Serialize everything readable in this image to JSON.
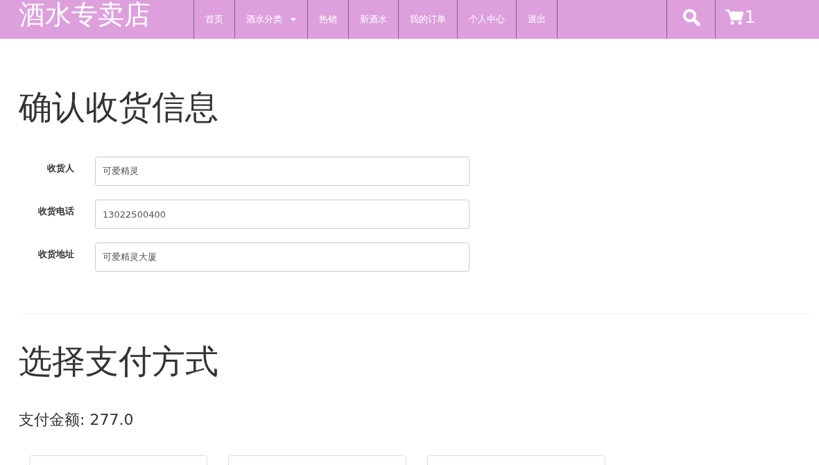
{
  "navbar": {
    "brand": "酒水专卖店",
    "items": [
      {
        "label": "首页",
        "kind": "link"
      },
      {
        "label": "酒水分类",
        "kind": "dropdown"
      },
      {
        "label": "热销",
        "kind": "link"
      },
      {
        "label": "新酒水",
        "kind": "link"
      },
      {
        "label": "我的订单",
        "kind": "link"
      },
      {
        "label": "个人中心",
        "kind": "link"
      },
      {
        "label": "退出",
        "kind": "link"
      }
    ],
    "cart_count": "1"
  },
  "shipping": {
    "title": "确认收货信息",
    "fields": [
      {
        "label": "收货人",
        "value": "可爱精灵"
      },
      {
        "label": "收货电话",
        "value": "13022500400"
      },
      {
        "label": "收货地址",
        "value": "可爱精灵大厦"
      }
    ]
  },
  "payment": {
    "title": "选择支付方式",
    "amount_label": "支付金额: 277.0",
    "options": [
      {
        "kind": "card"
      },
      {
        "kind": "card"
      },
      {
        "kind": "card"
      }
    ]
  }
}
